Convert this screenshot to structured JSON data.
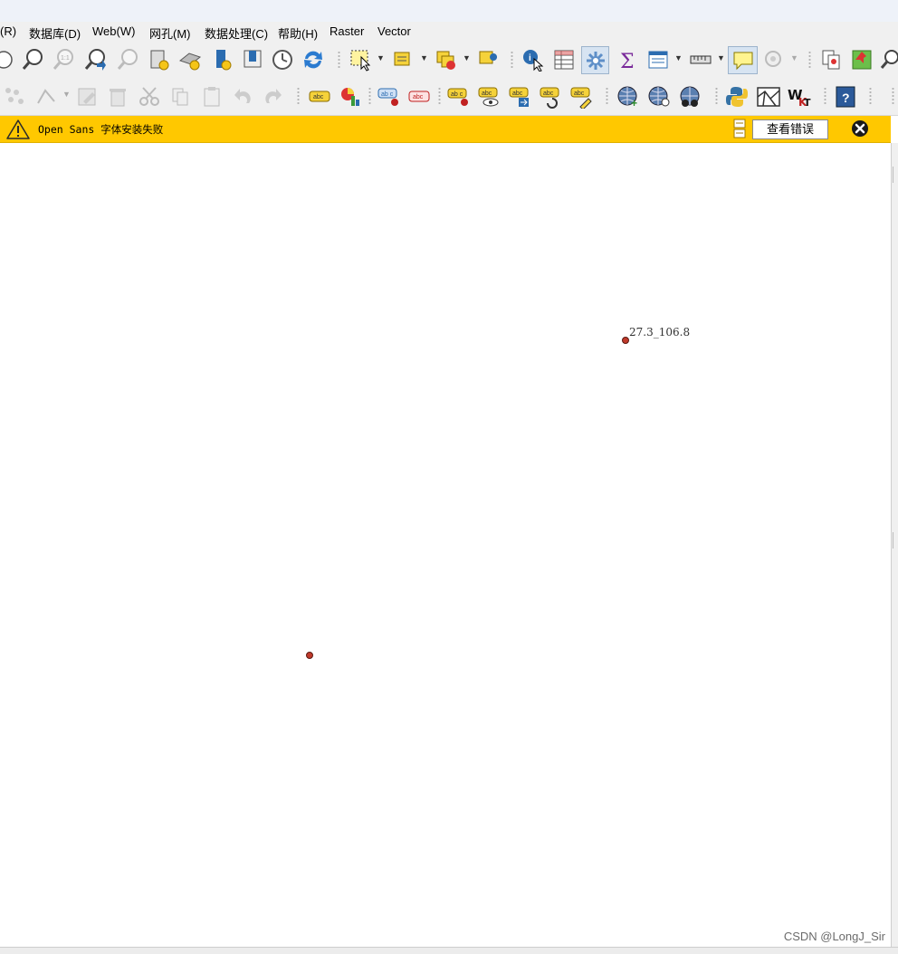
{
  "menubar": {
    "items": [
      "(R)",
      "数据库(D)",
      "Web(W)",
      "网孔(M)",
      "数据处理(C)",
      "帮助(H)",
      "Raster",
      "Vector"
    ]
  },
  "toolbar1": {
    "icons": [
      "pan-icon",
      "zoom-in-icon",
      "zoom-native-icon",
      "zoom-last-icon",
      "zoom-next-icon",
      "new-bookmark-icon",
      "show-bookmarks-icon",
      "new-decoration-icon",
      "temporal-icon",
      "refresh-icon",
      "select-features-icon",
      "select-by-value-icon",
      "deselect-icon",
      "select-location-icon",
      "identify-icon",
      "attribute-table-icon",
      "field-calculator-icon",
      "statistics-icon",
      "open-table-icon",
      "measure-icon",
      "map-tips-icon",
      "locator-icon",
      "copy-features-icon",
      "georeferencer-icon",
      "zoom-glass-icon"
    ]
  },
  "toolbar2": {
    "icons": [
      "digitize-icon",
      "vertex-tool-icon",
      "edit-attributes-icon",
      "delete-icon",
      "cut-icon",
      "copy-icon",
      "paste-icon",
      "undo-icon",
      "redo-icon",
      "label-icon",
      "diagram-icon",
      "pin-label-icon",
      "unpin-label-icon",
      "highlight-label-icon",
      "show-hide-label-icon",
      "move-label-icon",
      "rotate-label-icon",
      "change-label-icon",
      "wms-icon",
      "wfs-icon",
      "wcs-icon",
      "python-icon",
      "layout-icon",
      "wkt-icon",
      "help-icon"
    ]
  },
  "message_bar": {
    "text": "Open Sans 字体安装失败",
    "button": "查看错误",
    "warning_icon": "warning-icon",
    "close_icon": "close-icon"
  },
  "map": {
    "point_label": "27.3_106.8",
    "point_color": "#c0392b"
  },
  "watermark": "CSDN @LongJ_Sir",
  "colors": {
    "message_bar": "#ffc800",
    "toolbar": "#f0f0f0"
  }
}
